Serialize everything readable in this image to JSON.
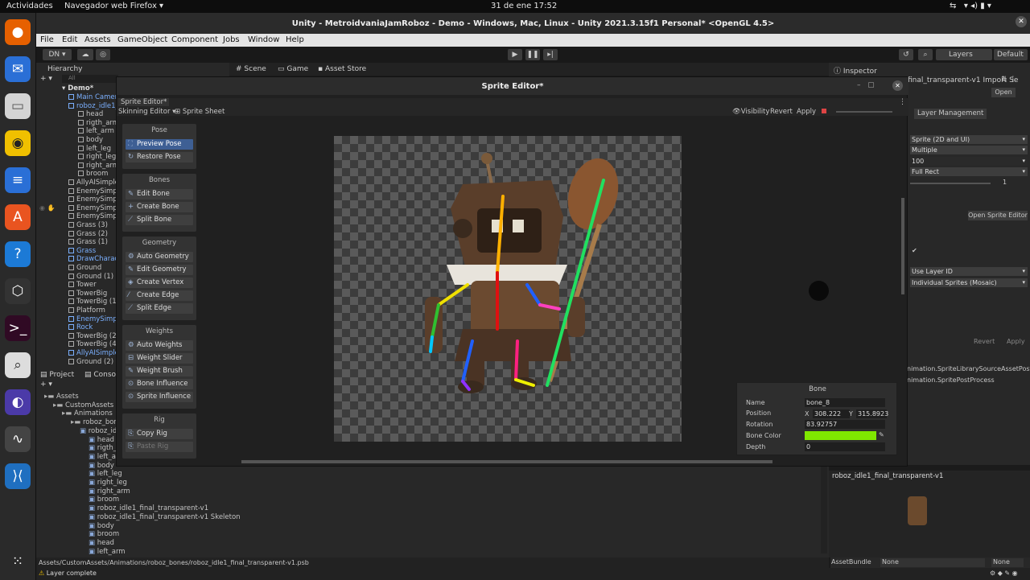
{
  "system_bar": {
    "activities": "Actividades",
    "browser": "Navegador web Firefox ▾",
    "clock": "31 de ene  17:52"
  },
  "window_title": "Unity - MetroidvaniaJamRoboz - Demo - Windows, Mac, Linux - Unity 2021.3.15f1 Personal* <OpenGL 4.5>",
  "menu": [
    "File",
    "Edit",
    "Assets",
    "GameObject",
    "Component",
    "Jobs",
    "Window",
    "Help"
  ],
  "toolbar": {
    "account": "DN ▾",
    "layers": "Layers",
    "layout": "Default"
  },
  "hierarchy": {
    "tab": "Hierarchy",
    "search_placeholder": "All",
    "scene": "Demo*",
    "items": [
      {
        "label": "Main Camer",
        "depth": 1,
        "blue": true
      },
      {
        "label": "roboz_idle1_",
        "depth": 1,
        "blue": true
      },
      {
        "label": "head",
        "depth": 2,
        "blue": false
      },
      {
        "label": "rigth_arm",
        "depth": 2,
        "blue": false
      },
      {
        "label": "left_arm",
        "depth": 2,
        "blue": false
      },
      {
        "label": "body",
        "depth": 2,
        "blue": false
      },
      {
        "label": "left_leg",
        "depth": 2,
        "blue": false
      },
      {
        "label": "right_leg",
        "depth": 2,
        "blue": false
      },
      {
        "label": "right_arm",
        "depth": 2,
        "blue": false
      },
      {
        "label": "broom",
        "depth": 2,
        "blue": false
      },
      {
        "label": "AllyAISimple",
        "depth": 1,
        "blue": false
      },
      {
        "label": "EnemySimpl",
        "depth": 1,
        "blue": false
      },
      {
        "label": "EnemySimpl",
        "depth": 1,
        "blue": false
      },
      {
        "label": "EnemySimpl",
        "depth": 1,
        "blue": false
      },
      {
        "label": "EnemySimpl",
        "depth": 1,
        "blue": false
      },
      {
        "label": "Grass (3)",
        "depth": 1,
        "blue": false
      },
      {
        "label": "Grass (2)",
        "depth": 1,
        "blue": false
      },
      {
        "label": "Grass (1)",
        "depth": 1,
        "blue": false
      },
      {
        "label": "Grass",
        "depth": 1,
        "blue": true
      },
      {
        "label": "DrawCharac",
        "depth": 1,
        "blue": true
      },
      {
        "label": "Ground",
        "depth": 1,
        "blue": false
      },
      {
        "label": "Ground (1)",
        "depth": 1,
        "blue": false
      },
      {
        "label": "Tower",
        "depth": 1,
        "blue": false
      },
      {
        "label": "TowerBig",
        "depth": 1,
        "blue": false
      },
      {
        "label": "TowerBig (1)",
        "depth": 1,
        "blue": false
      },
      {
        "label": "Platform",
        "depth": 1,
        "blue": false
      },
      {
        "label": "EnemySimpl",
        "depth": 1,
        "blue": true
      },
      {
        "label": "Rock",
        "depth": 1,
        "blue": true
      },
      {
        "label": "TowerBig (2)",
        "depth": 1,
        "blue": false
      },
      {
        "label": "TowerBig (4)",
        "depth": 1,
        "blue": false
      },
      {
        "label": "AllyAISimple",
        "depth": 1,
        "blue": true
      },
      {
        "label": "Ground (2)",
        "depth": 1,
        "blue": false
      }
    ]
  },
  "scene_tabs": {
    "scene": "Scene",
    "game": "Game",
    "asset_store": "Asset Store"
  },
  "sprite_editor": {
    "title": "Sprite Editor*",
    "tab": "Sprite Editor*",
    "mode": "Skinning Editor ▾",
    "sprite_sheet": "Sprite Sheet",
    "visibility": "Visibility",
    "revert": "Revert",
    "apply": "Apply",
    "groups": [
      {
        "header": "Pose",
        "buttons": [
          {
            "label": "Preview Pose",
            "selected": true,
            "disabled": false
          },
          {
            "label": "Restore Pose",
            "selected": false,
            "disabled": false
          }
        ]
      },
      {
        "header": "Bones",
        "buttons": [
          {
            "label": "Edit Bone",
            "selected": false,
            "disabled": false
          },
          {
            "label": "Create Bone",
            "selected": false,
            "disabled": false
          },
          {
            "label": "Split Bone",
            "selected": false,
            "disabled": false
          }
        ]
      },
      {
        "header": "Geometry",
        "buttons": [
          {
            "label": "Auto Geometry",
            "selected": false,
            "disabled": false
          },
          {
            "label": "Edit Geometry",
            "selected": false,
            "disabled": false
          },
          {
            "label": "Create Vertex",
            "selected": false,
            "disabled": false
          },
          {
            "label": "Create Edge",
            "selected": false,
            "disabled": false
          },
          {
            "label": "Split Edge",
            "selected": false,
            "disabled": false
          }
        ]
      },
      {
        "header": "Weights",
        "buttons": [
          {
            "label": "Auto Weights",
            "selected": false,
            "disabled": false
          },
          {
            "label": "Weight Slider",
            "selected": false,
            "disabled": false
          },
          {
            "label": "Weight Brush",
            "selected": false,
            "disabled": false
          },
          {
            "label": "Bone Influence",
            "selected": false,
            "disabled": false
          },
          {
            "label": "Sprite Influence",
            "selected": false,
            "disabled": false
          }
        ]
      },
      {
        "header": "Rig",
        "buttons": [
          {
            "label": "Copy Rig",
            "selected": false,
            "disabled": false
          },
          {
            "label": "Paste Rig",
            "selected": false,
            "disabled": true
          }
        ]
      }
    ],
    "bone_panel": {
      "title": "Bone",
      "name_label": "Name",
      "name": "bone_8",
      "position_label": "Position",
      "x_label": "X",
      "x": "308.222",
      "y_label": "Y",
      "y": "315.8923",
      "rotation_label": "Rotation",
      "rotation": "83.92757",
      "color_label": "Bone Color",
      "color": "#7fe800",
      "depth_label": "Depth",
      "depth": "0"
    }
  },
  "inspector": {
    "tab": "Inspector",
    "asset_title": "final_transparent-v1 Import Se",
    "open": "Open",
    "layer_management": "Layer Management",
    "texture_type": "Sprite (2D and UI)",
    "sprite_mode": "Multiple",
    "ppu": "100",
    "mesh_type": "Full Rect",
    "slider_value": "1",
    "open_sprite_editor": "Open Sprite Editor",
    "layer_id": "Use Layer ID",
    "mosaic": "Individual Sprites (Mosaic)",
    "revert": "Revert",
    "apply": "Apply",
    "processors": [
      "nimation.SpriteLibrarySourceAssetPostPr",
      "nimation.SpritePostProcess"
    ],
    "preview_title": "roboz_idle1_final_transparent-v1",
    "asset_bundle_label": "AssetBundle",
    "asset_bundle": "None",
    "variant": "None"
  },
  "project": {
    "tabs": [
      "Project",
      "Console"
    ],
    "tree": [
      {
        "label": "Assets",
        "depth": 0
      },
      {
        "label": "CustomAssets",
        "depth": 1
      },
      {
        "label": "Animations",
        "depth": 2
      },
      {
        "label": "roboz_bones",
        "depth": 3
      },
      {
        "label": "roboz_idle",
        "depth": 4
      },
      {
        "label": "head",
        "depth": 5
      },
      {
        "label": "rigth_am",
        "depth": 5
      },
      {
        "label": "left_arm",
        "depth": 5
      },
      {
        "label": "body",
        "depth": 5
      },
      {
        "label": "left_leg",
        "depth": 5
      },
      {
        "label": "right_leg",
        "depth": 5
      },
      {
        "label": "right_arm",
        "depth": 5
      },
      {
        "label": "broom",
        "depth": 5
      },
      {
        "label": "roboz_idle1_final_transparent-v1",
        "depth": 5
      },
      {
        "label": "roboz_idle1_final_transparent-v1 Skeleton",
        "depth": 5
      },
      {
        "label": "body",
        "depth": 5
      },
      {
        "label": "broom",
        "depth": 5
      },
      {
        "label": "head",
        "depth": 5
      },
      {
        "label": "left_arm",
        "depth": 5
      }
    ],
    "path": "Assets/CustomAssets/Animations/roboz_bones/roboz_idle1_final_transparent-v1.psb"
  },
  "status": "Layer complete"
}
